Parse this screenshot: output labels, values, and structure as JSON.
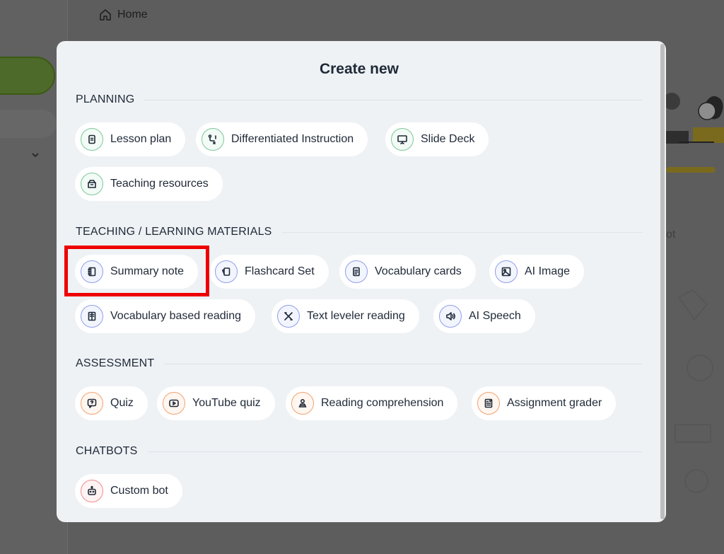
{
  "background": {
    "breadcrumb": {
      "home_label": "Home",
      "home_icon": "home-icon"
    },
    "fragment_text": "ot"
  },
  "modal": {
    "title": "Create new",
    "sections": {
      "planning": {
        "title": "PLANNING",
        "items": [
          {
            "label": "Lesson plan",
            "icon": "clipboard-icon",
            "color": "green"
          },
          {
            "label": "Differentiated Instruction",
            "icon": "route-icon",
            "color": "green"
          },
          {
            "label": "Slide Deck",
            "icon": "presentation-icon",
            "color": "green"
          },
          {
            "label": "Teaching resources",
            "icon": "box-icon",
            "color": "green"
          }
        ]
      },
      "materials": {
        "title": "TEACHING / LEARNING MATERIALS",
        "items": [
          {
            "label": "Summary note",
            "icon": "notebook-icon",
            "color": "blue",
            "highlighted": true
          },
          {
            "label": "Flashcard Set",
            "icon": "flashcards-icon",
            "color": "blue"
          },
          {
            "label": "Vocabulary cards",
            "icon": "document-icon",
            "color": "blue"
          },
          {
            "label": "AI Image",
            "icon": "image-icon",
            "color": "blue"
          },
          {
            "label": "Vocabulary based reading",
            "icon": "book-icon",
            "color": "blue"
          },
          {
            "label": "Text leveler reading",
            "icon": "ruler-pencil-icon",
            "color": "blue"
          },
          {
            "label": "AI Speech",
            "icon": "speaker-icon",
            "color": "blue"
          }
        ]
      },
      "assessment": {
        "title": "ASSESSMENT",
        "items": [
          {
            "label": "Quiz",
            "icon": "question-bubble-icon",
            "color": "orange"
          },
          {
            "label": "YouTube quiz",
            "icon": "youtube-icon",
            "color": "orange"
          },
          {
            "label": "Reading comprehension",
            "icon": "reader-icon",
            "color": "orange"
          },
          {
            "label": "Assignment grader",
            "icon": "grader-icon",
            "color": "orange"
          }
        ]
      },
      "chatbots": {
        "title": "CHATBOTS",
        "items": [
          {
            "label": "Custom bot",
            "icon": "robot-icon",
            "color": "red"
          }
        ]
      }
    }
  },
  "colors": {
    "overlay": "#5d5d5d",
    "modal_bg": "#eef2f5",
    "highlight": "#ee0000",
    "green_accent": "#7cc79a",
    "blue_accent": "#8f9ee8",
    "orange_accent": "#f0a271",
    "red_accent": "#ef8a8a"
  }
}
